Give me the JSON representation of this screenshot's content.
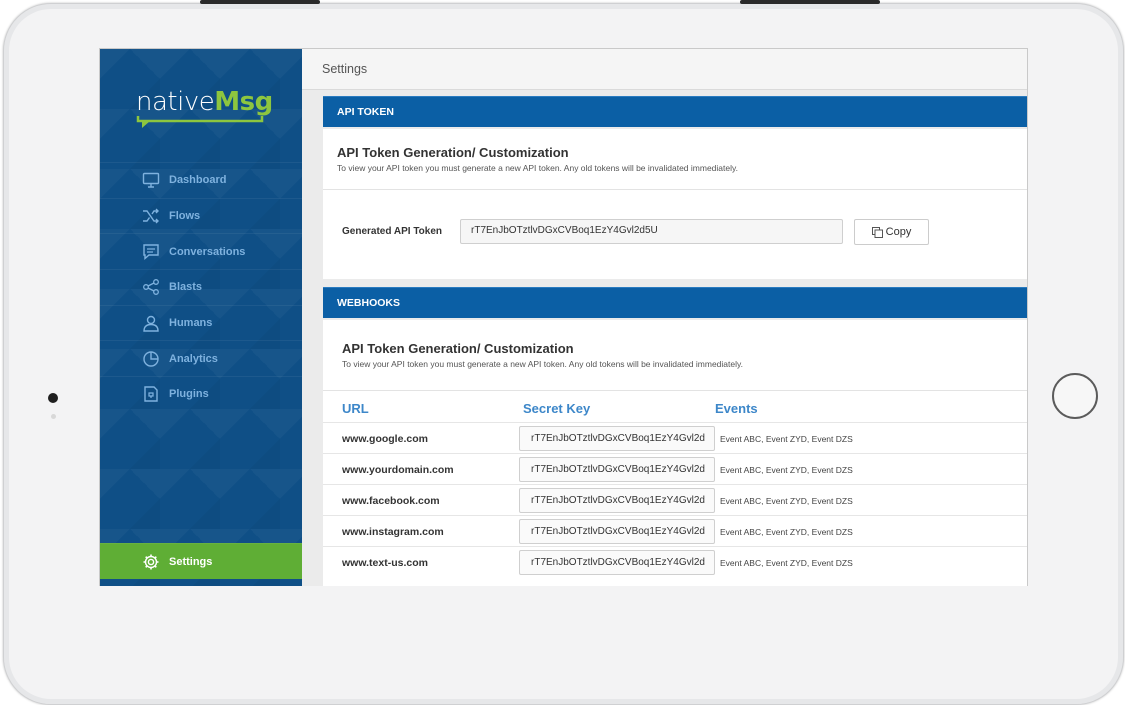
{
  "app": {
    "logo": {
      "part1": "native",
      "part2": "Msg"
    },
    "page_title": "Settings"
  },
  "sidebar": {
    "items": [
      {
        "label": "Dashboard",
        "icon": "monitor-icon"
      },
      {
        "label": "Flows",
        "icon": "shuffle-icon"
      },
      {
        "label": "Conversations",
        "icon": "chat-icon"
      },
      {
        "label": "Blasts",
        "icon": "share-icon"
      },
      {
        "label": "Humans",
        "icon": "user-icon"
      },
      {
        "label": "Analytics",
        "icon": "pie-chart-icon"
      },
      {
        "label": "Plugins",
        "icon": "plugin-icon"
      }
    ],
    "settings": {
      "label": "Settings",
      "icon": "gear-icon"
    }
  },
  "colors": {
    "sidebar_bg": "#0f4f86",
    "accent_green": "#5fae35",
    "section_blue": "#0b5fa5",
    "link_blue": "#3d87c9"
  },
  "api_token": {
    "section_title": "API TOKEN",
    "card_title": "API Token Generation/ Customization",
    "card_subtitle": "To view your API token you must generate a new API token. Any old tokens will be invalidated immediately.",
    "field_label": "Generated API Token",
    "token_value": "rT7EnJbOTztlvDGxCVBoq1EzY4Gvl2d5U",
    "copy_label": "Copy"
  },
  "webhooks": {
    "section_title": "WEBHOOKS",
    "card_title": "API Token Generation/ Customization",
    "card_subtitle": "To view your API token you must generate a new API token. Any old tokens will be invalidated immediately.",
    "columns": {
      "url": "URL",
      "secret_key": "Secret Key",
      "events": "Events"
    },
    "rows": [
      {
        "url": "www.google.com",
        "key": "rT7EnJbOTztlvDGxCVBoq1EzY4Gvl2d",
        "events": "Event ABC, Event ZYD, Event DZS"
      },
      {
        "url": "www.yourdomain.com",
        "key": "rT7EnJbOTztlvDGxCVBoq1EzY4Gvl2d",
        "events": "Event ABC, Event ZYD, Event DZS"
      },
      {
        "url": "www.facebook.com",
        "key": "rT7EnJbOTztlvDGxCVBoq1EzY4Gvl2d",
        "events": "Event ABC, Event ZYD, Event DZS"
      },
      {
        "url": "www.instagram.com",
        "key": "rT7EnJbOTztlvDGxCVBoq1EzY4Gvl2d",
        "events": "Event ABC, Event ZYD, Event DZS"
      },
      {
        "url": "www.text-us.com",
        "key": "rT7EnJbOTztlvDGxCVBoq1EzY4Gvl2d",
        "events": "Event ABC, Event ZYD, Event DZS"
      }
    ]
  }
}
